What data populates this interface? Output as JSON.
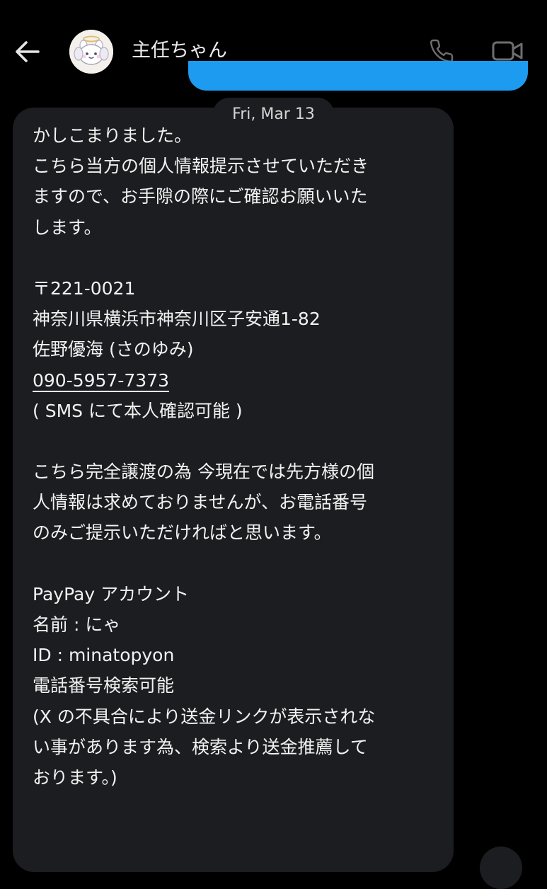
{
  "header": {
    "contact_name": "主任ちゃん",
    "back_icon": "arrow-left-icon",
    "call_icon": "phone-icon",
    "video_icon": "video-camera-icon",
    "accent_color": "#1d9bf0"
  },
  "date_separator": "Fri, Mar 13",
  "message": {
    "lines": {
      "l01": "かしこまりました。",
      "l02": "こちら当方の個人情報提示させていただき",
      "l03": "ますので、お手隙の際にご確認お願いいた",
      "l04": "します。",
      "l06": "〒221-0021",
      "l07": "神奈川県横浜市神奈川区子安通1-82",
      "l08": "佐野優海 (さのゆみ)",
      "l09": "090-5957-7373",
      "l10": "( SMS にて本人確認可能 )",
      "l12": "こちら完全譲渡の為 今現在では先方様の個",
      "l13": "人情報は求めておりませんが、お電話番号",
      "l14": "のみご提示いただければと思います。",
      "l16": "PayPay アカウント",
      "l17": "名前 : にゃ",
      "l18": "ID : minatopyon",
      "l19": "電話番号検索可能",
      "l20": "(X の不具合により送金リンクが表示されな",
      "l21": "い事があります為、検索より送金推薦して",
      "l22": "おります。)"
    }
  }
}
